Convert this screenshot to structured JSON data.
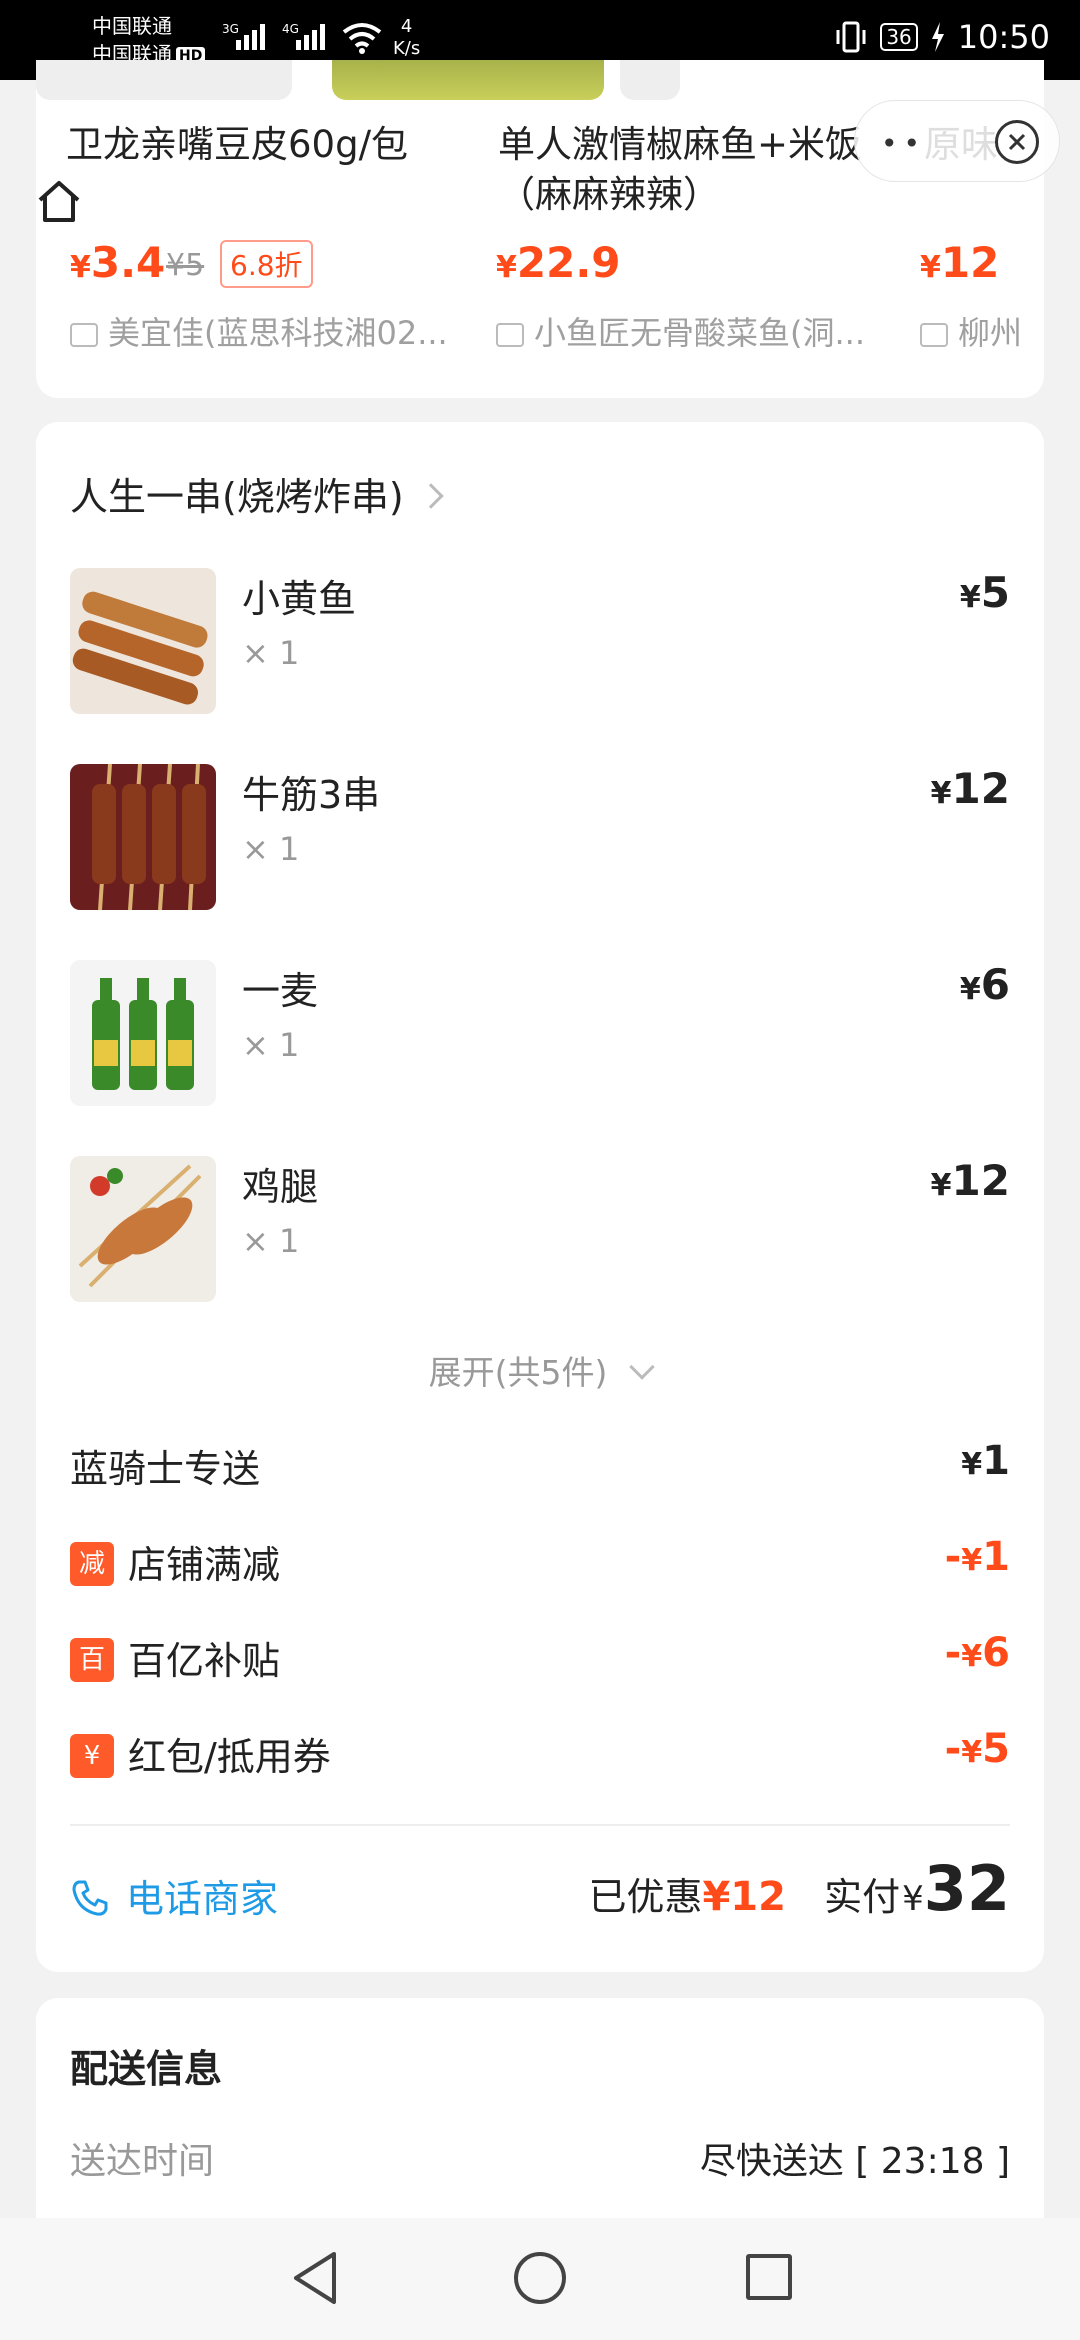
{
  "status_bar": {
    "carrier1": "中国联通",
    "carrier2": "中国联通",
    "hd": "HD",
    "sig1": "3G",
    "sig2": "4G",
    "net_speed_value": "4",
    "net_speed_unit": "K/s",
    "battery": "36",
    "time": "10:50"
  },
  "recommendations": [
    {
      "name": "卫龙亲嘴豆皮60g/包",
      "price_symbol": "¥",
      "price": "3.4",
      "old_price": "¥5",
      "discount": "6.8折",
      "shop": "美宜佳(蓝思科技湘02..."
    },
    {
      "name_line1": "单人激情椒麻鱼+米饭",
      "name_line2": "（麻麻辣辣）",
      "price_symbol": "¥",
      "price": "22.9",
      "shop": "小鱼匠无骨酸菜鱼(洞..."
    },
    {
      "name": "原味",
      "price_symbol": "¥",
      "price": "12",
      "shop": "柳州"
    }
  ],
  "capsule": {
    "dots": "••"
  },
  "order": {
    "shop_name": "人生一串(烧烤炸串)",
    "currency": "¥",
    "items": [
      {
        "name": "小黄鱼",
        "qty": "× 1",
        "price": "5"
      },
      {
        "name": "牛筋3串",
        "qty": "× 1",
        "price": "12"
      },
      {
        "name": "一麦",
        "qty": "× 1",
        "price": "6"
      },
      {
        "name": "鸡腿",
        "qty": "× 1",
        "price": "12"
      }
    ],
    "expand_label": "展开(共5件)",
    "fees": [
      {
        "label": "蓝骑士专送",
        "value": "1",
        "sign": ""
      },
      {
        "tag": "减",
        "label": "店铺满减",
        "value": "1",
        "sign": "-"
      },
      {
        "tag": "百",
        "label": "百亿补贴",
        "value": "6",
        "sign": "-"
      },
      {
        "tag": "¥",
        "label": "红包/抵用券",
        "value": "5",
        "sign": "-"
      }
    ],
    "call_label": "电话商家",
    "discount_label": "已优惠",
    "discount_value": "¥12",
    "pay_label": "实付",
    "pay_currency": "¥",
    "pay_value": "32"
  },
  "delivery": {
    "title": "配送信息",
    "time_label": "送达时间",
    "time_value": "尽快送达 [ 23:18 ]"
  },
  "colors": {
    "accent": "#ff4a1a",
    "link": "#1f9be6",
    "tag": "#ff5a2a"
  }
}
